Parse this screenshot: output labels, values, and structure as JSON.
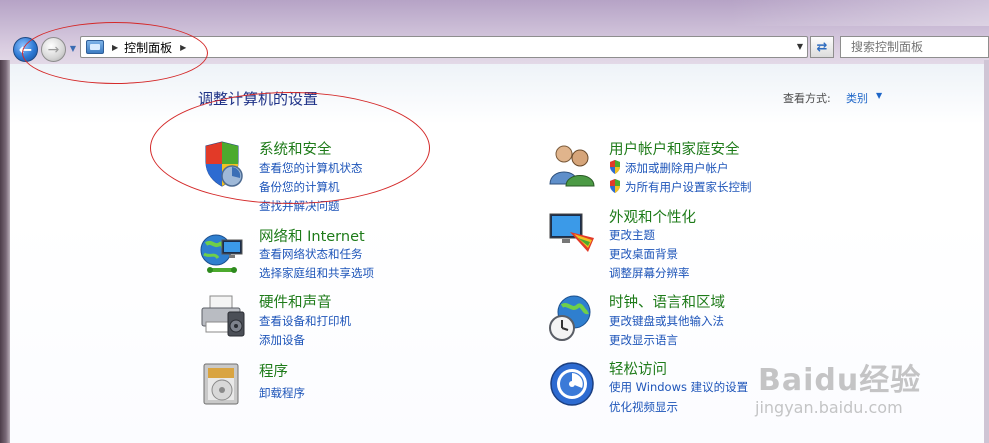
{
  "window": {
    "breadcrumb": [
      "控制面板"
    ],
    "search_placeholder": "搜索控制面板"
  },
  "content": {
    "title": "调整计算机的设置",
    "view_by_label": "查看方式:",
    "view_by_value": "类别"
  },
  "categories": [
    {
      "title": "系统和安全",
      "icon": "shield-icon",
      "links": [
        "查看您的计算机状态",
        "备份您的计算机",
        "查找并解决问题"
      ]
    },
    {
      "title": "网络和 Internet",
      "icon": "network-icon",
      "links": [
        "查看网络状态和任务",
        "选择家庭组和共享选项"
      ]
    },
    {
      "title": "硬件和声音",
      "icon": "printer-icon",
      "links": [
        "查看设备和打印机",
        "添加设备"
      ]
    },
    {
      "title": "程序",
      "icon": "programs-icon",
      "links": [
        "卸载程序"
      ]
    },
    {
      "title": "用户帐户和家庭安全",
      "icon": "users-icon",
      "links": [
        "添加或删除用户帐户",
        "为所有用户设置家长控制"
      ]
    },
    {
      "title": "外观和个性化",
      "icon": "appearance-icon",
      "links": [
        "更改主题",
        "更改桌面背景",
        "调整屏幕分辨率"
      ]
    },
    {
      "title": "时钟、语言和区域",
      "icon": "clock-globe-icon",
      "links": [
        "更改键盘或其他输入法",
        "更改显示语言"
      ]
    },
    {
      "title": "轻松访问",
      "icon": "ease-of-access-icon",
      "links": [
        "使用 Windows 建议的设置",
        "优化视频显示"
      ]
    }
  ],
  "watermark": {
    "logo": "Baidu经验",
    "url": "jingyan.baidu.com"
  },
  "colors": {
    "title_blue": "#1e3287",
    "category_green": "#1e7b19",
    "link_blue": "#1e55b9",
    "annotation_red": "#d42a2a"
  }
}
